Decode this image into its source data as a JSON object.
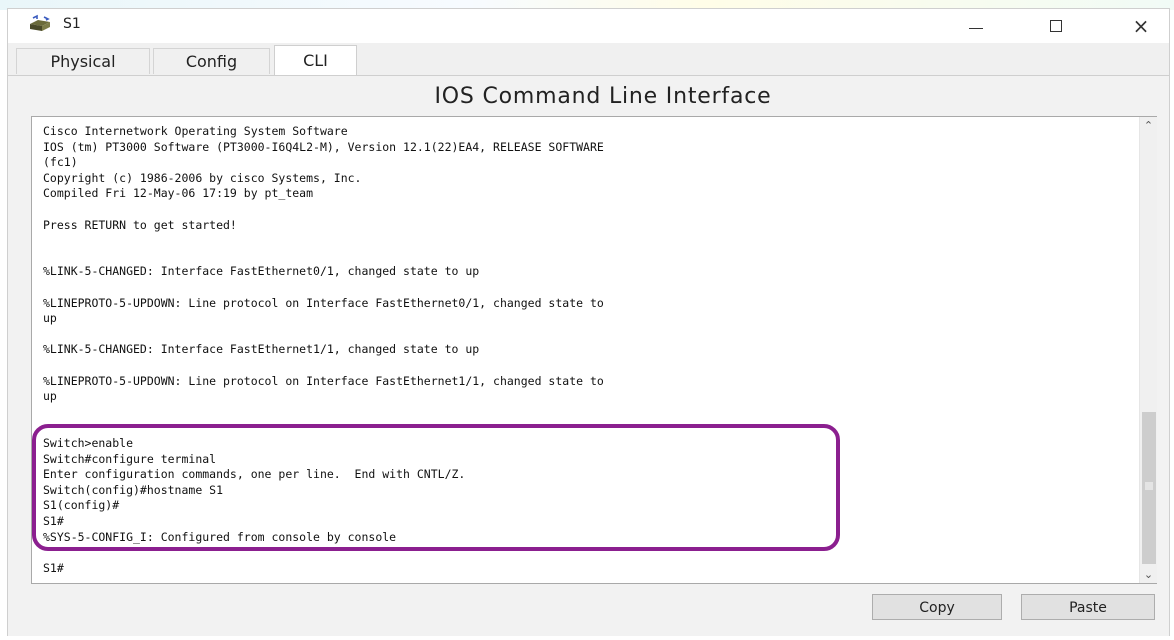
{
  "window": {
    "title": "S1",
    "icon": "switch-icon",
    "controls": [
      "minimize-icon",
      "maximize-icon",
      "close-icon"
    ],
    "close_glyph": "×"
  },
  "tabs": [
    {
      "label": "Physical",
      "active": false
    },
    {
      "label": "Config",
      "active": false
    },
    {
      "label": "CLI",
      "active": true
    }
  ],
  "cli": {
    "heading": "IOS Command Line Interface",
    "lines": [
      "Cisco Internetwork Operating System Software",
      "IOS (tm) PT3000 Software (PT3000-I6Q4L2-M), Version 12.1(22)EA4, RELEASE SOFTWARE",
      "(fc1)",
      "Copyright (c) 1986-2006 by cisco Systems, Inc.",
      "Compiled Fri 12-May-06 17:19 by pt_team",
      "",
      "Press RETURN to get started!",
      "",
      "",
      "%LINK-5-CHANGED: Interface FastEthernet0/1, changed state to up",
      "",
      "%LINEPROTO-5-UPDOWN: Line protocol on Interface FastEthernet0/1, changed state to",
      "up",
      "",
      "%LINK-5-CHANGED: Interface FastEthernet1/1, changed state to up",
      "",
      "%LINEPROTO-5-UPDOWN: Line protocol on Interface FastEthernet1/1, changed state to",
      "up",
      "",
      "",
      "Switch>enable",
      "Switch#configure terminal",
      "Enter configuration commands, one per line.  End with CNTL/Z.",
      "Switch(config)#hostname S1",
      "S1(config)#",
      "S1#",
      "%SYS-5-CONFIG_I: Configured from console by console",
      "",
      "S1#"
    ]
  },
  "buttons": {
    "copy": "Copy",
    "paste": "Paste"
  },
  "colors": {
    "highlight": "#8b1f8f"
  }
}
